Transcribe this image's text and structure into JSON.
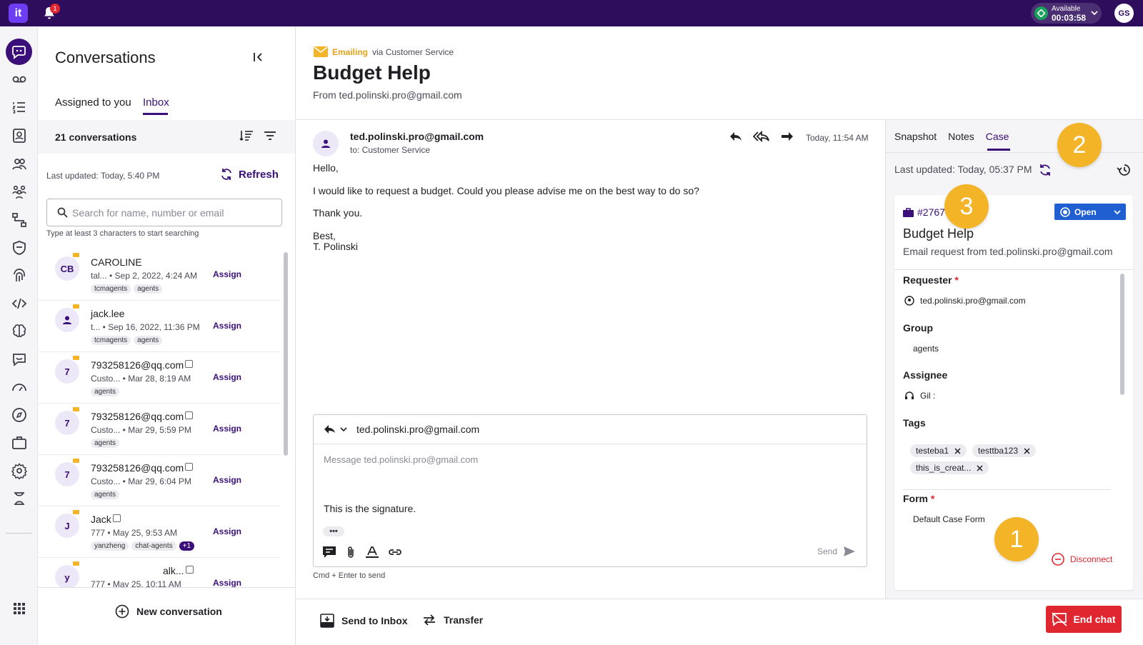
{
  "topbar": {
    "logo": "it",
    "notification_count": "1",
    "status_label": "Available",
    "status_timer": "00:03:58",
    "user_initials": "GS",
    "accent_color": "#2e0d5c"
  },
  "leftnav": {
    "icons": [
      "conversations-icon",
      "voicemail-icon",
      "list-icon",
      "contacts-icon",
      "people-icon",
      "team-icon",
      "flow-icon",
      "shield-icon",
      "fingerprint-icon",
      "code-icon",
      "brain-icon",
      "chat-bot-icon",
      "speed-icon",
      "compass-icon",
      "briefcase-icon",
      "settings-icon",
      "agent-icon",
      "apps-grid-icon"
    ]
  },
  "conversations": {
    "title": "Conversations",
    "tabs": {
      "assigned": "Assigned to you",
      "inbox": "Inbox"
    },
    "count_label": "21 conversations",
    "last_updated": "Last updated: Today, 5:40 PM",
    "refresh_label": "Refresh",
    "search_placeholder": "Search for name, number or email",
    "search_hint": "Type at least 3 characters to start searching",
    "assign_label": "Assign",
    "items": [
      {
        "avatar": "CB",
        "name": "CAROLINE",
        "meta": "tal...  • Sep 2, 2022, 4:24 AM",
        "tags": [
          "tcmagents",
          "agents"
        ]
      },
      {
        "avatar": "",
        "name": "jack.lee",
        "meta": "t...  • Sep 16, 2022, 11:36 PM",
        "tags": [
          "tcmagents",
          "agents"
        ]
      },
      {
        "avatar": "7",
        "name": "793258126@qq.com",
        "meta": "Custo...    • Mar 28, 8:19 AM",
        "tags": [
          "agents"
        ]
      },
      {
        "avatar": "7",
        "name": "793258126@qq.com",
        "meta": "Custo...    • Mar 29, 5:59 PM",
        "tags": [
          "agents"
        ]
      },
      {
        "avatar": "7",
        "name": "793258126@qq.com",
        "meta": "Custo...    • Mar 29, 6:04 PM",
        "tags": [
          "agents"
        ]
      },
      {
        "avatar": "J",
        "name": "Jack",
        "meta": "777  • May 25, 9:53 AM",
        "tags": [
          "yanzheng",
          "chat-agents"
        ],
        "more": "+1"
      },
      {
        "avatar": "y",
        "name": "alk...",
        "meta": "777  • May 25, 10:11 AM",
        "tags": []
      }
    ],
    "new_conversation": "New conversation"
  },
  "header": {
    "channel": "Emailing",
    "via": "via Customer Service",
    "title": "Budget Help",
    "from": "From ted.polinski.pro@gmail.com"
  },
  "message": {
    "sender": "ted.polinski.pro@gmail.com",
    "to": "to: Customer Service",
    "time": "Today, 11:54 AM",
    "lines": [
      "Hello,",
      "I would like to request a budget. Could you please advise me on the best way to do so?",
      "Thank you.",
      "Best,",
      "T. Polinski"
    ]
  },
  "reply": {
    "to_address": "ted.polinski.pro@gmail.com",
    "placeholder": "Message ted.polinski.pro@gmail.com",
    "signature": "This is the signature.",
    "more": "•••",
    "send": "Send",
    "hint": "Cmd + Enter to send"
  },
  "bottombar": {
    "send_to_inbox": "Send to Inbox",
    "transfer": "Transfer",
    "end_chat": "End chat"
  },
  "rightpanel": {
    "tabs": [
      "Snapshot",
      "Notes",
      "Case"
    ],
    "last_updated": "Last updated: Today, 05:37 PM",
    "case": {
      "id": "#2767",
      "status": "Open",
      "title": "Budget Help",
      "subtitle": "Email request from  ted.polinski.pro@gmail.com",
      "requester_label": "Requester",
      "requester_value": "ted.polinski.pro@gmail.com",
      "group_label": "Group",
      "group_value": "agents",
      "assignee_label": "Assignee",
      "assignee_value": "Gil :",
      "tags_label": "Tags",
      "tags": [
        "testeba1",
        "testtba123",
        "this_is_creat..."
      ],
      "form_label": "Form",
      "form_value": "Default Case Form",
      "disconnect": "Disconnect"
    },
    "required_mark": "*"
  },
  "callouts": [
    "1",
    "2",
    "3"
  ]
}
